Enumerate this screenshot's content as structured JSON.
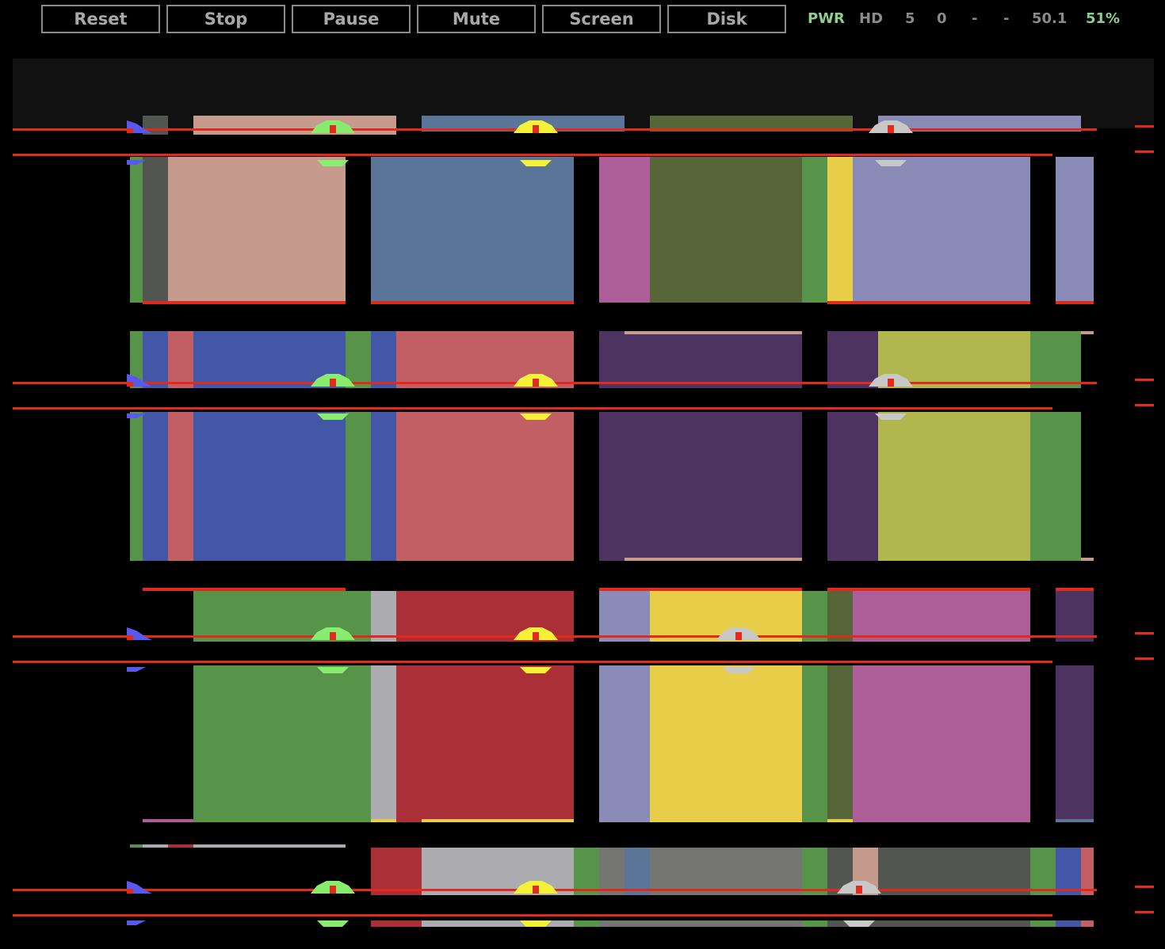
{
  "toolbar": {
    "reset_label": "Reset",
    "stop_label": "Stop",
    "pause_label": "Pause",
    "mute_label": "Mute",
    "screen_label": "Screen",
    "disk_label": "Disk"
  },
  "status": {
    "pwr": "PWR",
    "hd": "HD",
    "value1": "5",
    "value2": "0",
    "value3": "-",
    "value4": "-",
    "fps": "50.1",
    "speed": "51%"
  },
  "colors": {
    "button_border": "#8c8c8c",
    "button_text": "#a8a8a8",
    "status_text": "#8a8a8a",
    "status_active": "#8fce8f",
    "top_band": "#111111",
    "red_line": "#e02a1c"
  }
}
